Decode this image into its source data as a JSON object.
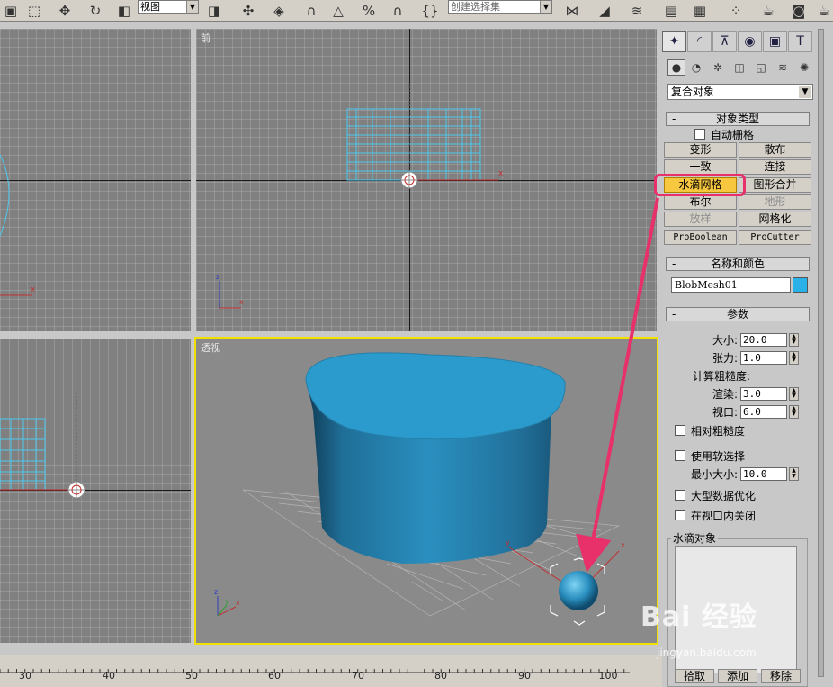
{
  "toolbar": {
    "view_combo": "视图",
    "selection_set_combo": "创建选择集",
    "icons": [
      "selection-region-icon",
      "move-icon",
      "rotate-icon",
      "scale-icon",
      "view-combo",
      "mirror-icon",
      "pivot-icon",
      "manipulate-icon",
      "angle-snap-icon",
      "percent-snap-icon",
      "spinner-snap-icon",
      "named-selection-icon",
      "mirror-axis-icon",
      "align-icon",
      "layer-icon",
      "curve-editor-icon",
      "schematic-icon",
      "material-editor-icon",
      "render-setup-icon",
      "render-icon"
    ]
  },
  "viewports": {
    "top_left": {
      "label": ""
    },
    "top_right": {
      "label": "前"
    },
    "bottom_left": {
      "label": ""
    },
    "bottom_right": {
      "label": "透视"
    }
  },
  "axis_labels": {
    "x": "x",
    "y": "y",
    "z": "z"
  },
  "timeline": {
    "ticks": [
      "30",
      "40",
      "50",
      "60",
      "70",
      "80",
      "90",
      "100"
    ]
  },
  "command_panel": {
    "tabs": [
      "create",
      "modify",
      "hierarchy",
      "motion",
      "display",
      "utilities"
    ],
    "subtabs": [
      "geometry",
      "shapes",
      "lights",
      "cameras",
      "helpers",
      "space-warps",
      "systems"
    ],
    "category": "复合对象",
    "object_type": {
      "title": "对象类型",
      "auto_grid_label": "自动栅格",
      "buttons": [
        {
          "label": "变形",
          "state": "normal"
        },
        {
          "label": "散布",
          "state": "normal"
        },
        {
          "label": "一致",
          "state": "normal"
        },
        {
          "label": "连接",
          "state": "normal"
        },
        {
          "label": "水滴网格",
          "state": "selected"
        },
        {
          "label": "图形合并",
          "state": "normal"
        },
        {
          "label": "布尔",
          "state": "normal"
        },
        {
          "label": "地形",
          "state": "disabled"
        },
        {
          "label": "放样",
          "state": "disabled"
        },
        {
          "label": "网格化",
          "state": "normal"
        },
        {
          "label": "ProBoolean",
          "state": "normal"
        },
        {
          "label": "ProCutter",
          "state": "normal"
        }
      ]
    },
    "name_color": {
      "title": "名称和颜色",
      "name": "BlobMesh01",
      "color": "#2ab2e8"
    },
    "params": {
      "title": "参数",
      "size_label": "大小:",
      "size": "20.0",
      "tension_label": "张力:",
      "tension": "1.0",
      "roughness_title": "计算粗糙度:",
      "render_label": "渲染:",
      "render": "3.0",
      "viewport_label": "视口:",
      "viewport": "6.0",
      "relative_roughness": "相对粗糙度",
      "use_soft_selection": "使用软选择",
      "min_size_label": "最小大小:",
      "min_size": "10.0",
      "large_data_opt": "大型数据优化",
      "off_in_viewport": "在视口内关闭",
      "blob_objects": "水滴对象",
      "pick_button": "拾取",
      "add_button": "添加",
      "remove_button": "移除"
    }
  },
  "watermark": {
    "brand": "Bai 经验",
    "url": "jingyan.baidu.com"
  },
  "colors": {
    "highlight": "#e8306a",
    "active_viewport": "#f0e000",
    "cylinder": "#2a95c5",
    "blob_grid": "#4cc8f0"
  }
}
